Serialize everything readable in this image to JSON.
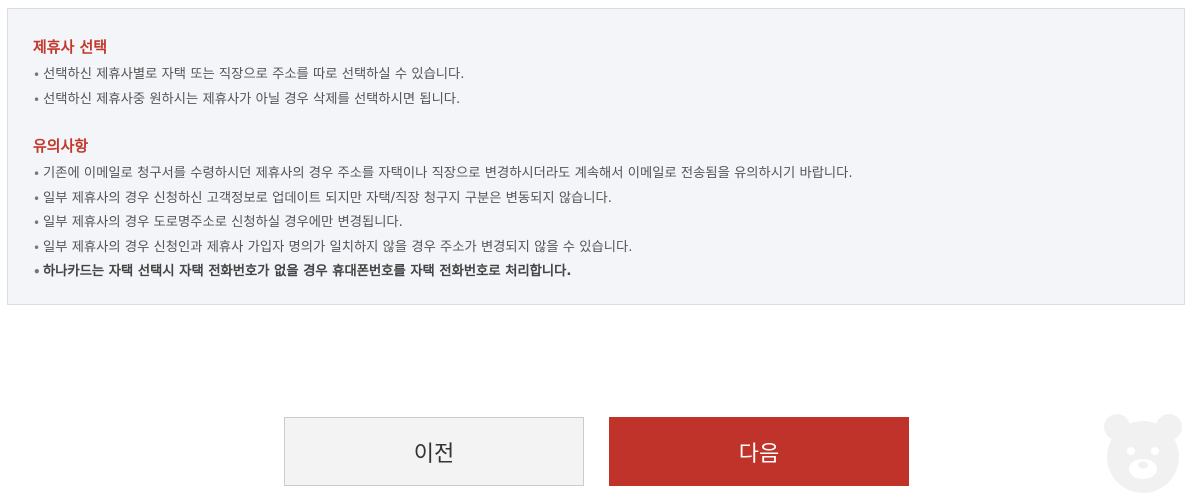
{
  "affiliate_selection": {
    "title": "제휴사 선택",
    "items": [
      "선택하신 제휴사별로 자택 또는 직장으로 주소를 따로 선택하실 수 있습니다.",
      "선택하신 제휴사중 원하시는 제휴사가 아닐 경우 삭제를 선택하시면 됩니다."
    ]
  },
  "notes": {
    "title": "유의사항",
    "items": [
      "기존에 이메일로 청구서를 수령하시던 제휴사의 경우 주소를 자택이나 직장으로 변경하시더라도 계속해서 이메일로 전송됨을 유의하시기 바랍니다.",
      "일부 제휴사의 경우 신청하신 고객정보로 업데이트 되지만 자택/직장 청구지 구분은 변동되지 않습니다.",
      "일부 제휴사의 경우 도로명주소로 신청하실 경우에만 변경됩니다.",
      "일부 제휴사의 경우 신청인과 제휴사 가입자 명의가 일치하지 않을 경우 주소가 변경되지 않을 수 있습니다.",
      "하나카드는 자택 선택시 자택 전화번호가 없을 경우 휴대폰번호를 자택 전화번호로 처리합니다."
    ]
  },
  "bullet_char": "•",
  "buttons": {
    "prev_label": "이전",
    "next_label": "다음"
  },
  "colors": {
    "accent": "#c0392b",
    "next_button": "#c0332a",
    "info_background": "#f4f5f9"
  },
  "icons": {
    "watermark": "bear-mascot-icon"
  }
}
